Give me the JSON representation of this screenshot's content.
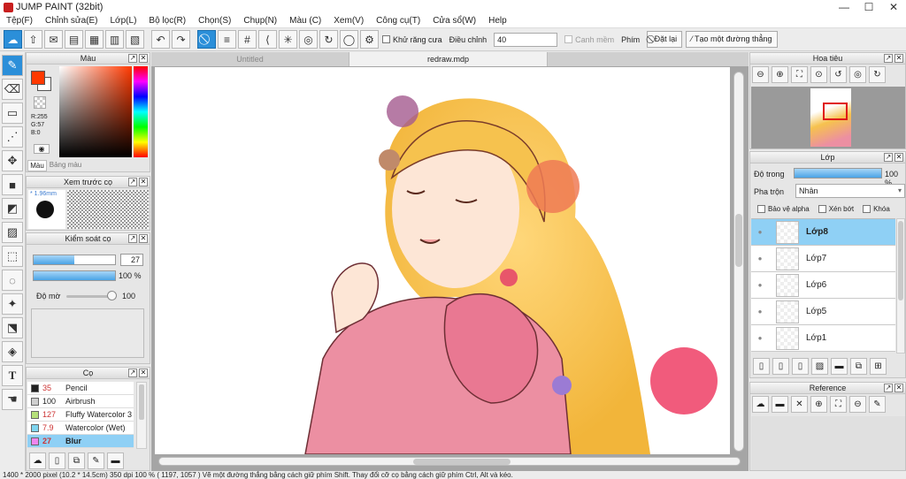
{
  "window": {
    "title": "JUMP PAINT (32bit)"
  },
  "menu": [
    "Tệp(F)",
    "Chỉnh sửa(E)",
    "Lớp(L)",
    "Bộ lọc(R)",
    "Chọn(S)",
    "Chụp(N)",
    "Màu (C)",
    "Xem(V)",
    "Công cụ(T)",
    "Cửa sổ(W)",
    "Help"
  ],
  "toolbar": {
    "antialias_label": "Khử răng cưa",
    "adjust_label": "Điều chỉnh",
    "adjust_value": "40",
    "canh_mem_label": "Canh mềm",
    "key_label": "Phím",
    "reset_label": "Đặt lại",
    "straight_line_label": "Tạo một đường thẳng"
  },
  "color_panel": {
    "title": "Màu",
    "r": "R:255",
    "g": "G:57",
    "b": "B:0",
    "tab_color": "Màu",
    "tab_palette": "Bảng màu",
    "foreground": "#ff3900"
  },
  "preview_panel": {
    "title": "Xem trước cọ",
    "size": "1.96mm"
  },
  "brush_control": {
    "title": "Kiểm soát cọ",
    "size_value": "27",
    "size_fill": 0.5,
    "opacity_value": "100 %",
    "opacity_fill": 1.0,
    "blur_label": "Độ mờ",
    "blur_value": "100",
    "blur_fill": 1.0
  },
  "brush_list": {
    "title": "Cọ",
    "items": [
      {
        "size": "35",
        "name": "Pencil",
        "color": "#222222"
      },
      {
        "size": "100",
        "name": "Airbrush",
        "color": "#cfcfcf"
      },
      {
        "size": "127",
        "name": "Fluffy Watercolor 3",
        "color": "#b5e07a"
      },
      {
        "size": "7.9",
        "name": "Watercolor (Wet)",
        "color": "#7fd5ef"
      },
      {
        "size": "27",
        "name": "Blur",
        "color": "#ef86ef"
      }
    ]
  },
  "canvas": {
    "tab_untitled": "Untitled",
    "tab_file": "redraw.mdp"
  },
  "navigator": {
    "title": "Hoa tiêu"
  },
  "layer_panel": {
    "title": "Lớp",
    "opacity_label": "Độ trong",
    "opacity_value": "100 %",
    "opacity_fill": 1.0,
    "blend_label": "Pha trộn",
    "blend_value": "Nhân",
    "protect_alpha": "Bảo vệ alpha",
    "clip": "Xén bớt",
    "lock": "Khóa",
    "layers": [
      "Lớp8",
      "Lớp7",
      "Lớp6",
      "Lớp5",
      "Lớp1"
    ]
  },
  "reference_panel": {
    "title": "Reference"
  },
  "status": "1400 * 2000 pixel   (10.2 * 14.5cm)   350 dpi   100 %   ( 1197, 1057 )   Vẽ một đường thẳng bằng cách giữ phím Shift. Thay đổi cỡ cọ bằng cách giữ phím Ctrl, Alt và kéo."
}
